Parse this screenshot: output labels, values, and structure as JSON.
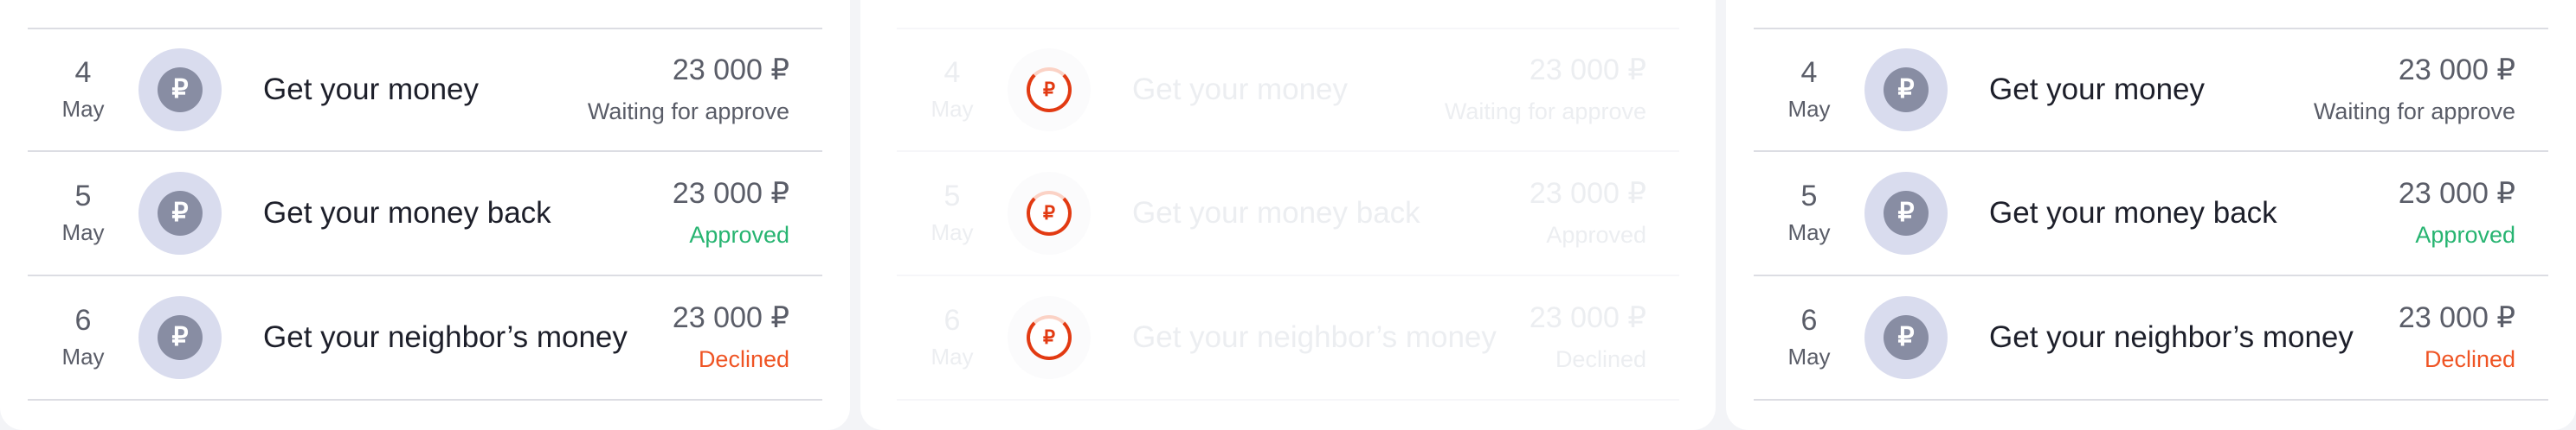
{
  "currency_symbol": "₽",
  "colors": {
    "approved": "#27b471",
    "declined": "#ef5424",
    "avatar_bg": "#d9dcee",
    "coin": "#888da3"
  },
  "panels": [
    {
      "state": "normal",
      "rows": [
        {
          "day": "4",
          "month": "May",
          "title": "Get your money",
          "amount": "23 000 ₽",
          "status": "Waiting for approve",
          "status_kind": "waiting"
        },
        {
          "day": "5",
          "month": "May",
          "title": "Get your money back",
          "amount": "23 000 ₽",
          "status": "Approved",
          "status_kind": "approved"
        },
        {
          "day": "6",
          "month": "May",
          "title": "Get your neighbor’s money",
          "amount": "23 000 ₽",
          "status": "Declined",
          "status_kind": "declined"
        }
      ]
    },
    {
      "state": "loading",
      "rows": [
        {
          "day": "4",
          "month": "May",
          "title": "Get your money",
          "amount": "23 000 ₽",
          "status": "Waiting for approve",
          "status_kind": "waiting"
        },
        {
          "day": "5",
          "month": "May",
          "title": "Get your money back",
          "amount": "23 000 ₽",
          "status": "Approved",
          "status_kind": "approved"
        },
        {
          "day": "6",
          "month": "May",
          "title": "Get your neighbor’s money",
          "amount": "23 000 ₽",
          "status": "Declined",
          "status_kind": "declined"
        }
      ]
    },
    {
      "state": "normal",
      "rows": [
        {
          "day": "4",
          "month": "May",
          "title": "Get your money",
          "amount": "23 000 ₽",
          "status": "Waiting for approve",
          "status_kind": "waiting"
        },
        {
          "day": "5",
          "month": "May",
          "title": "Get your money back",
          "amount": "23 000 ₽",
          "status": "Approved",
          "status_kind": "approved"
        },
        {
          "day": "6",
          "month": "May",
          "title": "Get your neighbor’s money",
          "amount": "23 000 ₽",
          "status": "Declined",
          "status_kind": "declined"
        }
      ]
    }
  ]
}
